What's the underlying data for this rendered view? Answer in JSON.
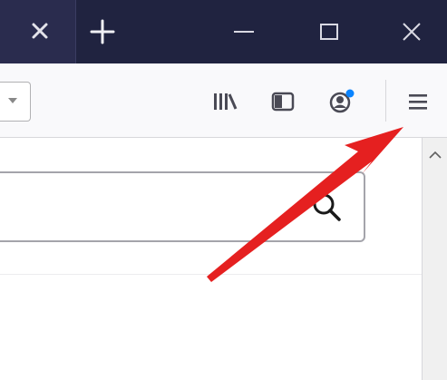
{
  "titlebar": {
    "tab_close_icon": "close-icon",
    "new_tab_icon": "plus-icon",
    "window_controls": [
      "minimize-icon",
      "maximize-icon",
      "close-icon"
    ]
  },
  "toolbar": {
    "buttons": [
      {
        "name": "library",
        "icon": "library-icon"
      },
      {
        "name": "sidebar",
        "icon": "sidebar-icon"
      },
      {
        "name": "account",
        "icon": "account-icon",
        "badge_color": "#0a84ff"
      },
      {
        "name": "menu",
        "icon": "hamburger-menu-icon"
      }
    ]
  },
  "content": {
    "search_icon": "search-icon"
  },
  "annotation": {
    "type": "arrow",
    "color": "#e52020",
    "points_to": "menu"
  },
  "colors": {
    "titlebar": "#202340",
    "toolbar": "#f9f9fb",
    "arrow": "#e52020"
  }
}
